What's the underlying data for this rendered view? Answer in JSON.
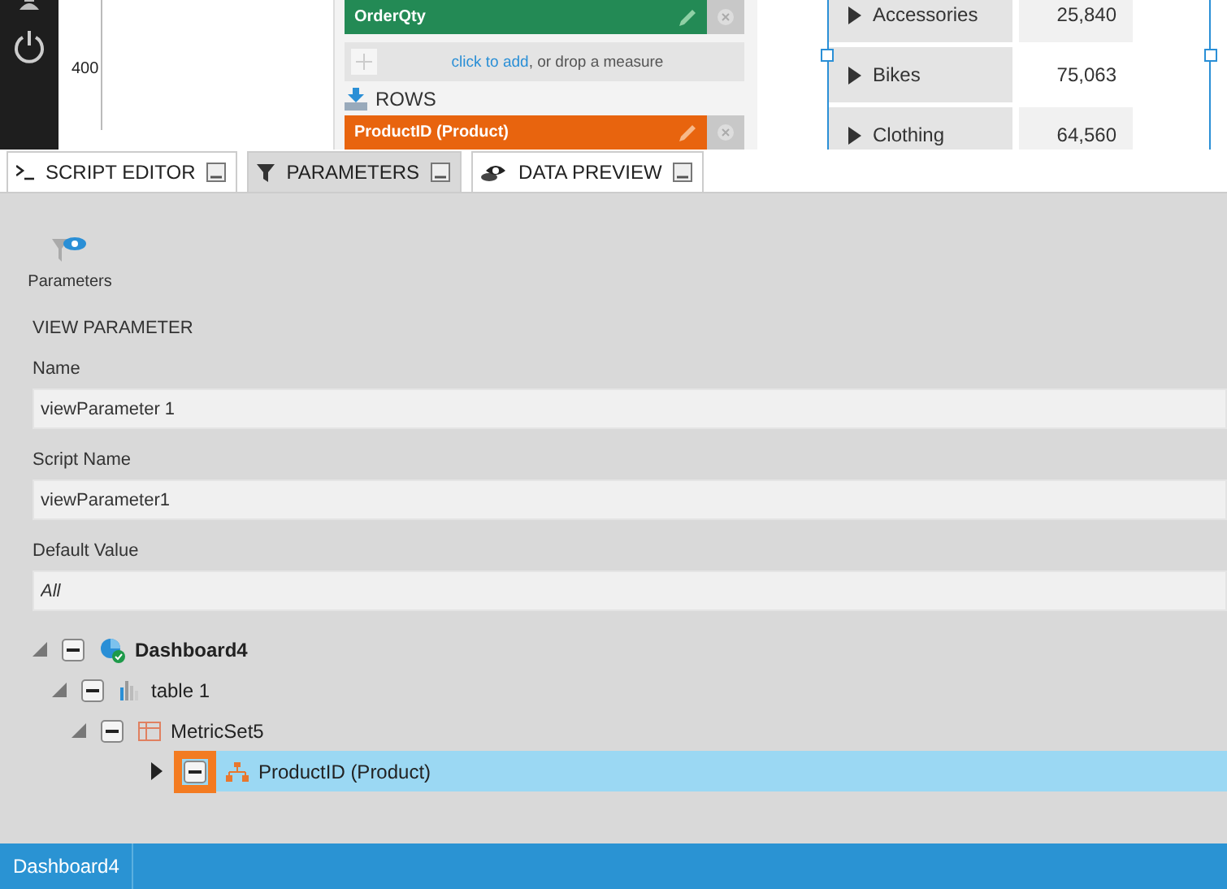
{
  "chart": {
    "axis_label": "400"
  },
  "fields_panel": {
    "measures": [
      {
        "label": "OrderQty"
      }
    ],
    "add_prompt": {
      "link": "click to add",
      "text": ", or drop a measure"
    },
    "rows_header": "ROWS",
    "rows": [
      {
        "label": "ProductID (Product)"
      }
    ]
  },
  "table": {
    "rows": [
      {
        "label": "Accessories",
        "value": "25,840"
      },
      {
        "label": "Bikes",
        "value": "75,063"
      },
      {
        "label": "Clothing",
        "value": "64,560"
      }
    ]
  },
  "tabs": [
    {
      "label": "SCRIPT EDITOR",
      "kind": "script",
      "selected": false
    },
    {
      "label": "PARAMETERS",
      "kind": "filter",
      "selected": true
    },
    {
      "label": "DATA PREVIEW",
      "kind": "preview",
      "selected": false
    }
  ],
  "toolbar": {
    "button": "Parameters"
  },
  "section_title": "VIEW PARAMETER",
  "form": [
    {
      "label": "Name",
      "value": "viewParameter 1"
    },
    {
      "label": "Script Name",
      "value": "viewParameter1"
    },
    {
      "label": "Default Value",
      "placeholder": "All"
    }
  ],
  "tree": [
    {
      "label": "Dashboard4",
      "kind": "dashboard",
      "expanded": true,
      "selected": false,
      "highlighted": false,
      "children": [
        {
          "label": "table 1",
          "kind": "table",
          "expanded": true,
          "selected": false,
          "highlighted": false,
          "children": [
            {
              "label": "MetricSet5",
              "kind": "metricset",
              "expanded": true,
              "selected": false,
              "highlighted": false,
              "children": [
                {
                  "label": "ProductID (Product)",
                  "kind": "hierarchy",
                  "expanded": false,
                  "selected": true,
                  "highlighted": true
                }
              ]
            }
          ]
        }
      ]
    }
  ],
  "status_bar": {
    "tab": "Dashboard4"
  }
}
